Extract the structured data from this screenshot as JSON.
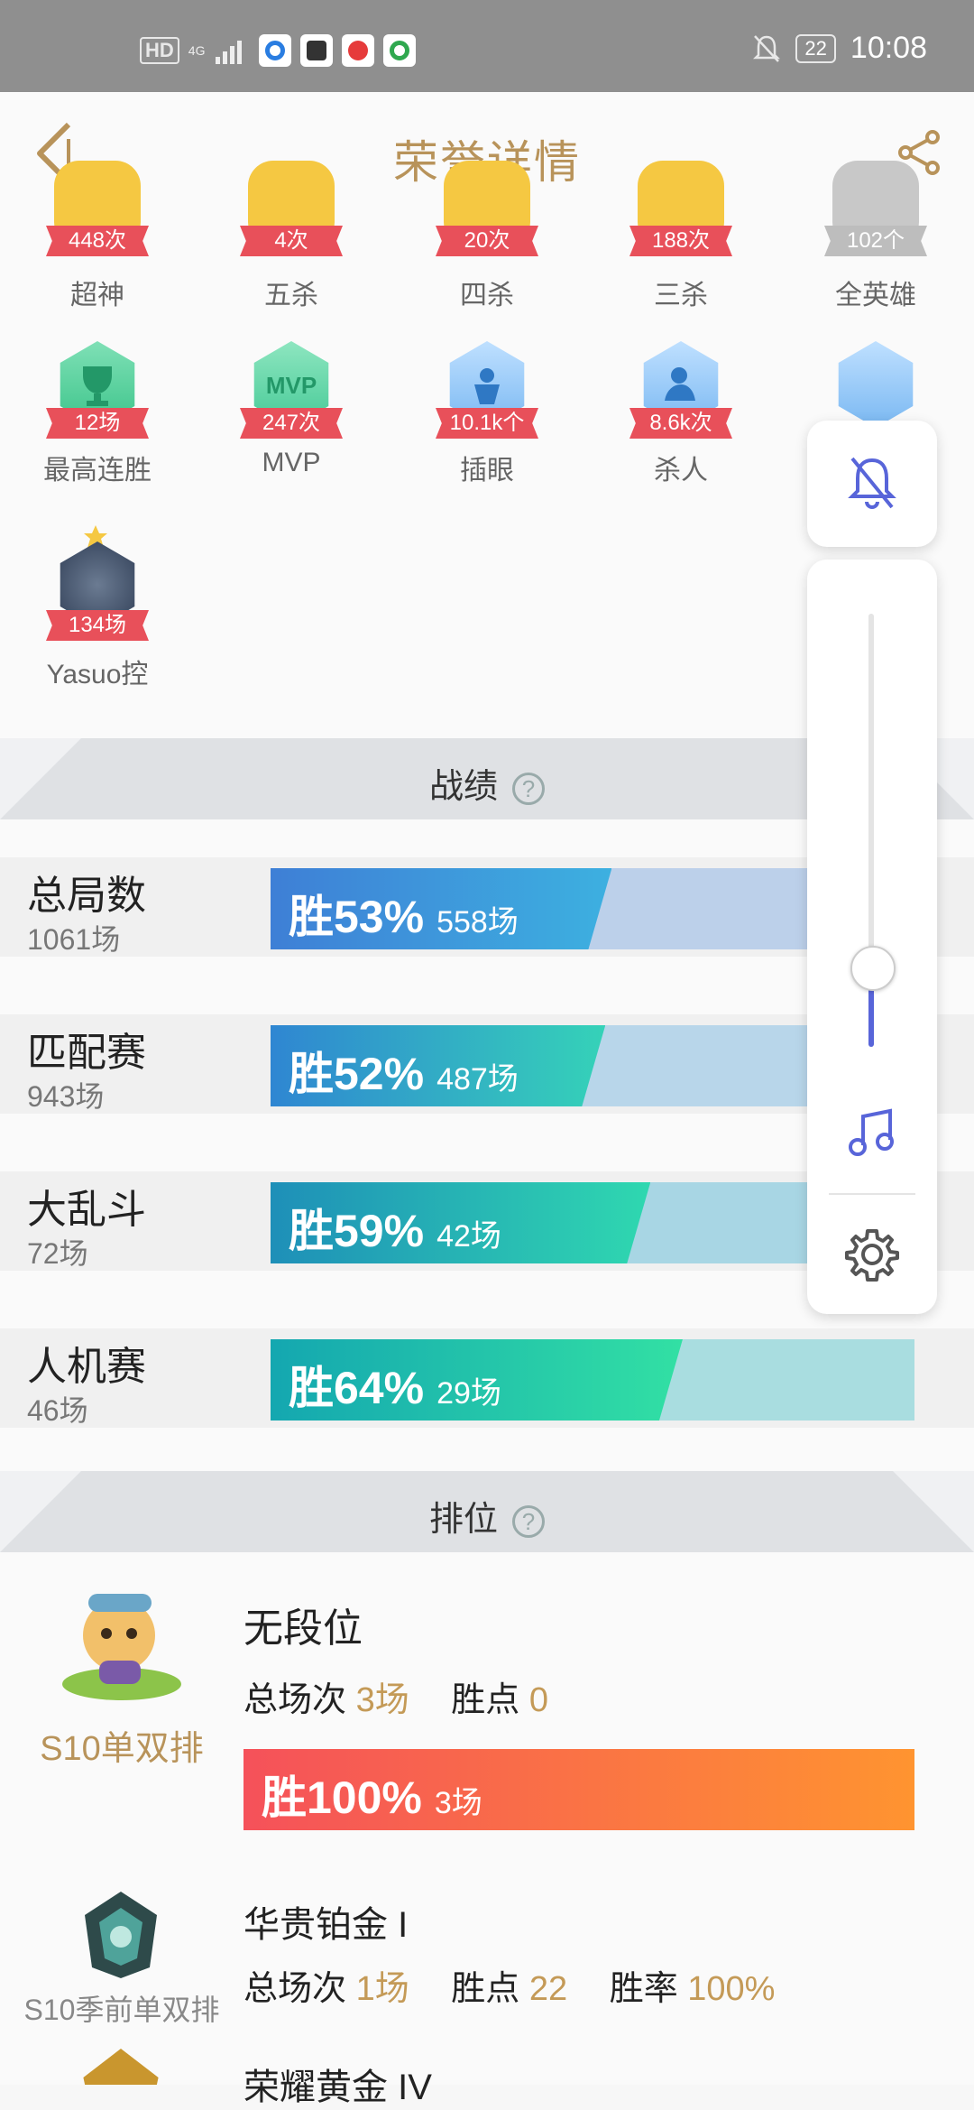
{
  "status_bar": {
    "hd": "HD",
    "network": "4G",
    "battery": "22",
    "time": "10:08"
  },
  "header": {
    "title": "荣誉详情"
  },
  "badges_row1": [
    {
      "count": "448次",
      "label": "超神"
    },
    {
      "count": "4次",
      "label": "五杀"
    },
    {
      "count": "20次",
      "label": "四杀"
    },
    {
      "count": "188次",
      "label": "三杀"
    },
    {
      "count": "102个",
      "label": "全英雄"
    }
  ],
  "badges_row2": [
    {
      "count": "12场",
      "label": "最高连胜",
      "icon": "trophy-icon"
    },
    {
      "count": "247次",
      "label": "MVP",
      "icon": "mvp-icon"
    },
    {
      "count": "10.1k个",
      "label": "插眼",
      "icon": "ward-icon"
    },
    {
      "count": "8.6k次",
      "label": "杀人",
      "icon": "kill-icon"
    }
  ],
  "badge_champion": {
    "count": "134场",
    "label": "Yasuo控"
  },
  "stats_section": {
    "title": "战绩",
    "rows": [
      {
        "name": "总局数",
        "games": "1061场",
        "win": "胜53%",
        "count": "558场",
        "rate": 0.53
      },
      {
        "name": "匹配赛",
        "games": "943场",
        "win": "胜52%",
        "count": "487场",
        "rate": 0.52
      },
      {
        "name": "大乱斗",
        "games": "72场",
        "win": "胜59%",
        "count": "42场",
        "rate": 0.59
      },
      {
        "name": "人机赛",
        "games": "46场",
        "win": "胜64%",
        "count": "29场",
        "rate": 0.64
      }
    ]
  },
  "rank_section": {
    "title": "排位",
    "card1": {
      "season": "S10单双排",
      "tier": "无段位",
      "total_label": "总场次",
      "total_value": "3场",
      "points_label": "胜点",
      "points_value": "0",
      "win": "胜100%",
      "count": "3场",
      "rate": 1.0
    },
    "card2": {
      "season": "S10季前单双排",
      "tier": "华贵铂金 I",
      "total_label": "总场次",
      "total_value": "1场",
      "points_label": "胜点",
      "points_value": "22",
      "winrate_label": "胜率",
      "winrate_value": "100%"
    },
    "card3": {
      "tier": "荣耀黄金 IV"
    }
  },
  "colors": {
    "accent_gold": "#b8935a",
    "slider_blue": "#5865d9",
    "ribbon_red": "#e8505a"
  },
  "volume_level": 0.18
}
